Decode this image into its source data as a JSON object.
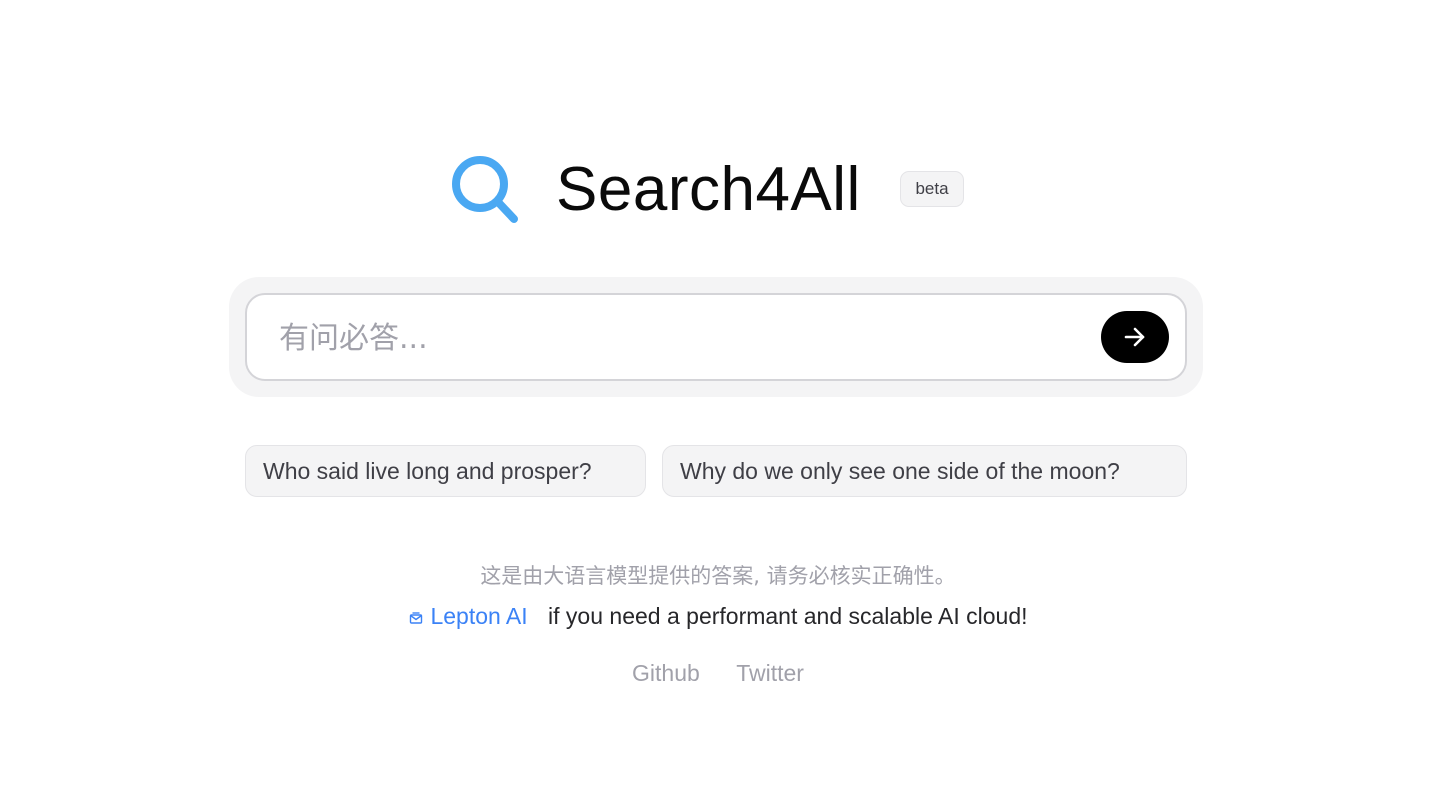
{
  "header": {
    "logo_icon": "search-icon",
    "brand": "Search4All",
    "badge": "beta",
    "accent_color": "#4aa8f2"
  },
  "search": {
    "placeholder": "有问必答...",
    "value": "",
    "submit_icon": "arrow-right-icon"
  },
  "suggestions": [
    "Who said live long and prosper?",
    "Why do we only see one side of the moon?"
  ],
  "disclaimer": "这是由大语言模型提供的答案, 请务必核实正确性。",
  "promo": {
    "icon": "mail-icon",
    "link_label": "Lepton AI",
    "text": "if you need a performant and scalable AI cloud!"
  },
  "footer": {
    "links": [
      "Github",
      "Twitter"
    ]
  }
}
